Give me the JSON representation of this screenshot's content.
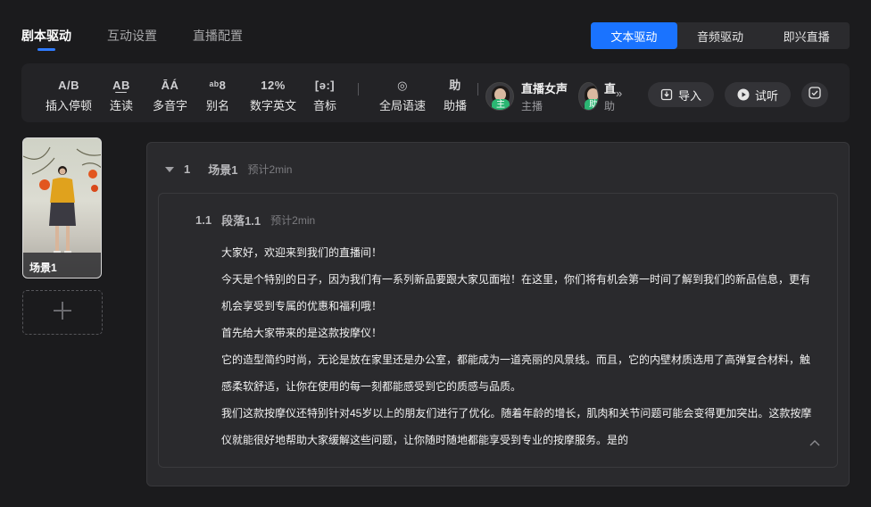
{
  "top_tabs": [
    {
      "label": "剧本驱动",
      "active": true
    },
    {
      "label": "互动设置",
      "active": false
    },
    {
      "label": "直播配置",
      "active": false
    }
  ],
  "mode_switch": [
    {
      "label": "文本驱动",
      "active": true
    },
    {
      "label": "音频驱动",
      "active": false
    },
    {
      "label": "即兴直播",
      "active": false
    }
  ],
  "toolbar": {
    "tools": [
      {
        "icon_text": "A/B",
        "label": "插入停顿"
      },
      {
        "icon_text": "A͟B",
        "label": "连读"
      },
      {
        "icon_text": "ĀÁ",
        "label": "多音字"
      },
      {
        "icon_text": "ᵃᵇ8",
        "label": "别名"
      },
      {
        "icon_text": "12%",
        "label": "数字英文"
      },
      {
        "icon_text": "[ə:]",
        "label": "音标"
      },
      {
        "icon_text": "◎",
        "label": "全局语速"
      },
      {
        "icon_text": "助",
        "label": "助播"
      }
    ],
    "voices": [
      {
        "tag": "主",
        "name": "直播女声",
        "role": "主播"
      },
      {
        "tag": "助",
        "name": "直",
        "role": "助"
      }
    ],
    "more_glyph": "»",
    "import_label": "导入",
    "listen_label": "试听"
  },
  "scenes": [
    {
      "label": "场景1"
    }
  ],
  "editor": {
    "scene": {
      "num": "1",
      "name": "场景1",
      "estimate": "预计2min"
    },
    "paragraph": {
      "num": "1.1",
      "name": "段落1.1",
      "estimate": "预计2min",
      "lines": [
        "大家好，欢迎来到我们的直播间！",
        "今天是个特别的日子，因为我们有一系列新品要跟大家见面啦！在这里，你们将有机会第一时间了解到我们的新品信息，更有",
        "机会享受到专属的优惠和福利哦！",
        "首先给大家带来的是这款按摩仪！",
        "它的造型简约时尚，无论是放在家里还是办公室，都能成为一道亮丽的风景线。而且，它的内壁材质选用了高弹复合材料，触",
        "感柔软舒适，让你在使用的每一刻都能感受到它的质感与品质。",
        "我们这款按摩仪还特别针对45岁以上的朋友们进行了优化。随着年龄的增长，肌肉和关节问题可能会变得更加突出。这款按摩",
        "仪就能很好地帮助大家缓解这些问题，让你随时随地都能享受到专业的按摩服务。是的"
      ]
    }
  },
  "colors": {
    "accent": "#1a73ff",
    "background": "#1b1b1d",
    "panel": "#2a2a2d",
    "voice_tag": "#2bb673"
  }
}
